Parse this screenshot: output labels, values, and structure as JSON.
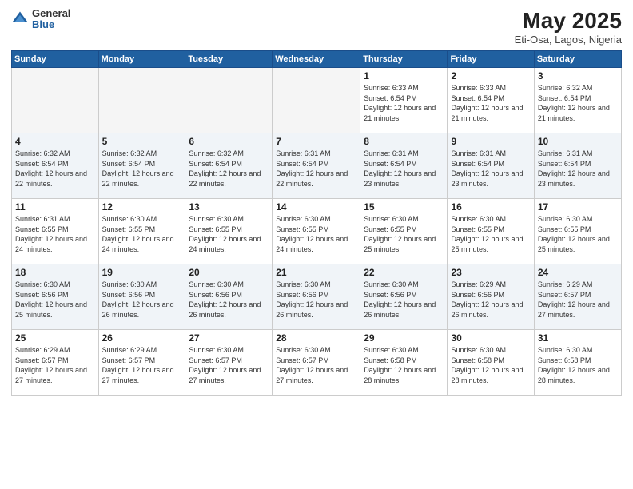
{
  "logo": {
    "general": "General",
    "blue": "Blue"
  },
  "header": {
    "month_year": "May 2025",
    "location": "Eti-Osa, Lagos, Nigeria"
  },
  "days_of_week": [
    "Sunday",
    "Monday",
    "Tuesday",
    "Wednesday",
    "Thursday",
    "Friday",
    "Saturday"
  ],
  "weeks": [
    [
      {
        "num": "",
        "info": ""
      },
      {
        "num": "",
        "info": ""
      },
      {
        "num": "",
        "info": ""
      },
      {
        "num": "",
        "info": ""
      },
      {
        "num": "1",
        "info": "Sunrise: 6:33 AM\nSunset: 6:54 PM\nDaylight: 12 hours\nand 21 minutes."
      },
      {
        "num": "2",
        "info": "Sunrise: 6:33 AM\nSunset: 6:54 PM\nDaylight: 12 hours\nand 21 minutes."
      },
      {
        "num": "3",
        "info": "Sunrise: 6:32 AM\nSunset: 6:54 PM\nDaylight: 12 hours\nand 21 minutes."
      }
    ],
    [
      {
        "num": "4",
        "info": "Sunrise: 6:32 AM\nSunset: 6:54 PM\nDaylight: 12 hours\nand 22 minutes."
      },
      {
        "num": "5",
        "info": "Sunrise: 6:32 AM\nSunset: 6:54 PM\nDaylight: 12 hours\nand 22 minutes."
      },
      {
        "num": "6",
        "info": "Sunrise: 6:32 AM\nSunset: 6:54 PM\nDaylight: 12 hours\nand 22 minutes."
      },
      {
        "num": "7",
        "info": "Sunrise: 6:31 AM\nSunset: 6:54 PM\nDaylight: 12 hours\nand 22 minutes."
      },
      {
        "num": "8",
        "info": "Sunrise: 6:31 AM\nSunset: 6:54 PM\nDaylight: 12 hours\nand 23 minutes."
      },
      {
        "num": "9",
        "info": "Sunrise: 6:31 AM\nSunset: 6:54 PM\nDaylight: 12 hours\nand 23 minutes."
      },
      {
        "num": "10",
        "info": "Sunrise: 6:31 AM\nSunset: 6:54 PM\nDaylight: 12 hours\nand 23 minutes."
      }
    ],
    [
      {
        "num": "11",
        "info": "Sunrise: 6:31 AM\nSunset: 6:55 PM\nDaylight: 12 hours\nand 24 minutes."
      },
      {
        "num": "12",
        "info": "Sunrise: 6:30 AM\nSunset: 6:55 PM\nDaylight: 12 hours\nand 24 minutes."
      },
      {
        "num": "13",
        "info": "Sunrise: 6:30 AM\nSunset: 6:55 PM\nDaylight: 12 hours\nand 24 minutes."
      },
      {
        "num": "14",
        "info": "Sunrise: 6:30 AM\nSunset: 6:55 PM\nDaylight: 12 hours\nand 24 minutes."
      },
      {
        "num": "15",
        "info": "Sunrise: 6:30 AM\nSunset: 6:55 PM\nDaylight: 12 hours\nand 25 minutes."
      },
      {
        "num": "16",
        "info": "Sunrise: 6:30 AM\nSunset: 6:55 PM\nDaylight: 12 hours\nand 25 minutes."
      },
      {
        "num": "17",
        "info": "Sunrise: 6:30 AM\nSunset: 6:55 PM\nDaylight: 12 hours\nand 25 minutes."
      }
    ],
    [
      {
        "num": "18",
        "info": "Sunrise: 6:30 AM\nSunset: 6:56 PM\nDaylight: 12 hours\nand 25 minutes."
      },
      {
        "num": "19",
        "info": "Sunrise: 6:30 AM\nSunset: 6:56 PM\nDaylight: 12 hours\nand 26 minutes."
      },
      {
        "num": "20",
        "info": "Sunrise: 6:30 AM\nSunset: 6:56 PM\nDaylight: 12 hours\nand 26 minutes."
      },
      {
        "num": "21",
        "info": "Sunrise: 6:30 AM\nSunset: 6:56 PM\nDaylight: 12 hours\nand 26 minutes."
      },
      {
        "num": "22",
        "info": "Sunrise: 6:30 AM\nSunset: 6:56 PM\nDaylight: 12 hours\nand 26 minutes."
      },
      {
        "num": "23",
        "info": "Sunrise: 6:29 AM\nSunset: 6:56 PM\nDaylight: 12 hours\nand 26 minutes."
      },
      {
        "num": "24",
        "info": "Sunrise: 6:29 AM\nSunset: 6:57 PM\nDaylight: 12 hours\nand 27 minutes."
      }
    ],
    [
      {
        "num": "25",
        "info": "Sunrise: 6:29 AM\nSunset: 6:57 PM\nDaylight: 12 hours\nand 27 minutes."
      },
      {
        "num": "26",
        "info": "Sunrise: 6:29 AM\nSunset: 6:57 PM\nDaylight: 12 hours\nand 27 minutes."
      },
      {
        "num": "27",
        "info": "Sunrise: 6:30 AM\nSunset: 6:57 PM\nDaylight: 12 hours\nand 27 minutes."
      },
      {
        "num": "28",
        "info": "Sunrise: 6:30 AM\nSunset: 6:57 PM\nDaylight: 12 hours\nand 27 minutes."
      },
      {
        "num": "29",
        "info": "Sunrise: 6:30 AM\nSunset: 6:58 PM\nDaylight: 12 hours\nand 28 minutes."
      },
      {
        "num": "30",
        "info": "Sunrise: 6:30 AM\nSunset: 6:58 PM\nDaylight: 12 hours\nand 28 minutes."
      },
      {
        "num": "31",
        "info": "Sunrise: 6:30 AM\nSunset: 6:58 PM\nDaylight: 12 hours\nand 28 minutes."
      }
    ]
  ]
}
